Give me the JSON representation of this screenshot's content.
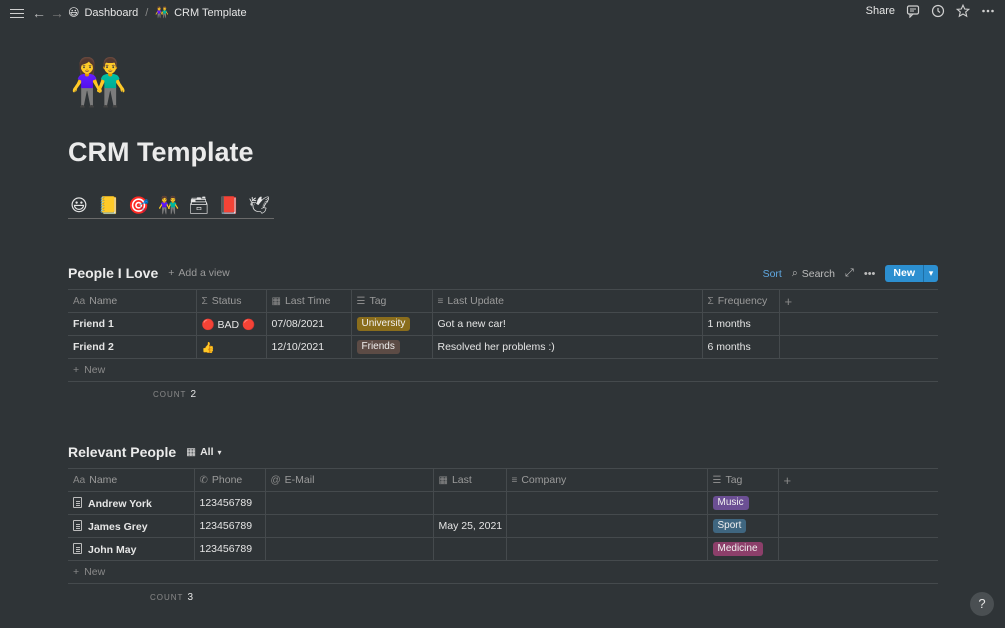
{
  "topbar": {
    "breadcrumb": [
      {
        "icon": "😃",
        "label": "Dashboard"
      },
      {
        "icon": "👫",
        "label": "CRM Template"
      }
    ],
    "share_label": "Share"
  },
  "page": {
    "icon": "👫",
    "title": "CRM Template",
    "emoji_links": [
      "😃",
      "📒",
      "🎯",
      "👫",
      "🗃",
      "📕",
      "🕊"
    ]
  },
  "people_i_love": {
    "title": "People I Love",
    "add_view": "Add a view",
    "sort": "Sort",
    "search": "Search",
    "new": "New",
    "columns": [
      "Name",
      "Status",
      "Last Time",
      "Tag",
      "Last Update",
      "Frequency"
    ],
    "column_icons": [
      "Aa",
      "Σ",
      "▦",
      "☰",
      "≡",
      "Σ"
    ],
    "rows": [
      {
        "name": "Friend 1",
        "status": "🔴 BAD 🔴",
        "last_time": "07/08/2021",
        "tag": "University",
        "tag_color": "#8a6d1c",
        "last_update": "Got a new car!",
        "frequency": "1 months"
      },
      {
        "name": "Friend 2",
        "status": "👍",
        "last_time": "12/10/2021",
        "tag": "Friends",
        "tag_color": "#5c4b45",
        "last_update": "Resolved her problems :)",
        "frequency": "6 months"
      }
    ],
    "new_row": "New",
    "count_label": "COUNT",
    "count_value": "2"
  },
  "relevant_people": {
    "title": "Relevant People",
    "view_label": "All",
    "columns": [
      "Name",
      "Phone",
      "E-Mail",
      "Last",
      "Company",
      "Tag"
    ],
    "column_icons": [
      "Aa",
      "✆",
      "@",
      "▦",
      "≡",
      "☰"
    ],
    "rows": [
      {
        "name": "Andrew York",
        "phone": "123456789",
        "email": "",
        "last": "",
        "company": "",
        "tag": "Music",
        "tag_color": "#6b4f94"
      },
      {
        "name": "James Grey",
        "phone": "123456789",
        "email": "",
        "last": "May 25, 2021",
        "company": "",
        "tag": "Sport",
        "tag_color": "#3f6680"
      },
      {
        "name": "John May",
        "phone": "123456789",
        "email": "",
        "last": "",
        "company": "",
        "tag": "Medicine",
        "tag_color": "#8c3f6a"
      }
    ],
    "new_row": "New",
    "count_label": "COUNT",
    "count_value": "3"
  },
  "help": "?"
}
